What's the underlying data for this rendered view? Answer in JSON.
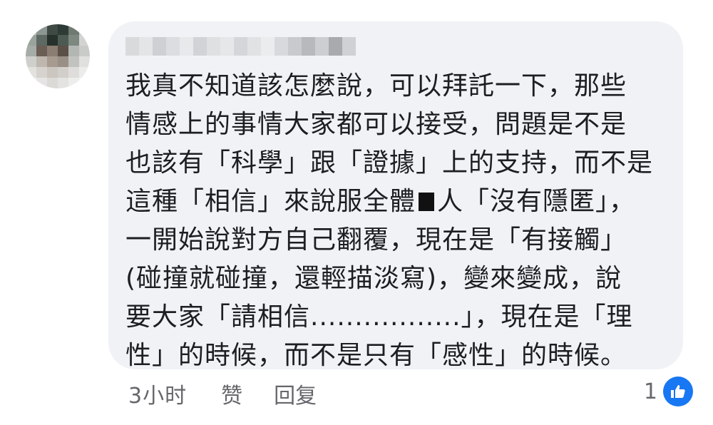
{
  "comment": {
    "lines": [
      "我真不知道該怎麼說，可以拜託一下，那些",
      "情感上的事情大家都可以接受，問題是不是",
      "也該有「科學」跟「證據」上的支持，而不是",
      "一開始說對方自己翻覆，現在是「有接觸」",
      "(碰撞就碰撞，還輕描淡寫)，變來變成，說",
      "要大家「請相信.................」，現在是「理",
      "性」的時候，而不是只有「感性」的時候。"
    ],
    "line4_before": "這種「相信」來說服全體",
    "line4_after": "人「沒有隱匿」，"
  },
  "footer": {
    "time": "3小时",
    "like_label": "赞",
    "reply_label": "回复",
    "reaction_count": "1"
  },
  "colors": {
    "bubble_bg": "#f0f2f5",
    "text": "#1c1e21",
    "secondary_text": "#65676b",
    "like_blue": "#1877f2"
  },
  "icons": {
    "like": "thumbs-up-icon"
  }
}
